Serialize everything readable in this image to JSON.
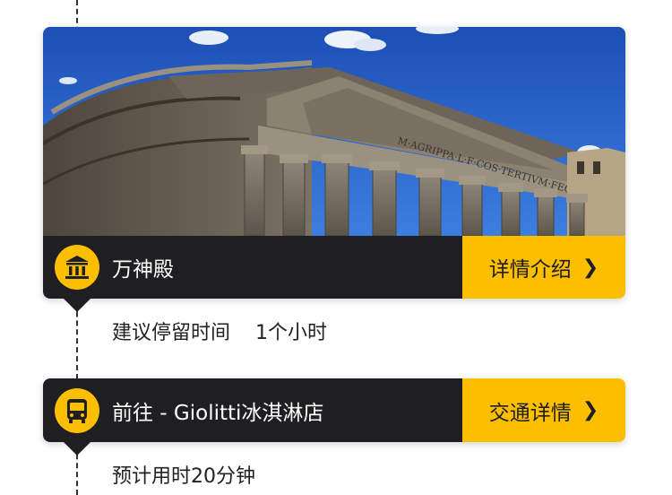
{
  "attraction": {
    "name": "万神殿",
    "detail_button": "详情介绍",
    "stay_label": "建议停留时间",
    "stay_value": "1个小时",
    "photo_icon": "pantheon-photo",
    "badge_icon": "landmark-columns-icon"
  },
  "transport": {
    "title": "前往 - Giolitti冰淇淋店",
    "detail_button": "交通详情",
    "duration": "预计用时20分钟",
    "badge_icon": "bus-icon"
  },
  "colors": {
    "accent": "#fbbf00",
    "bar_dark": "#1f1e21",
    "text": "#222222"
  }
}
